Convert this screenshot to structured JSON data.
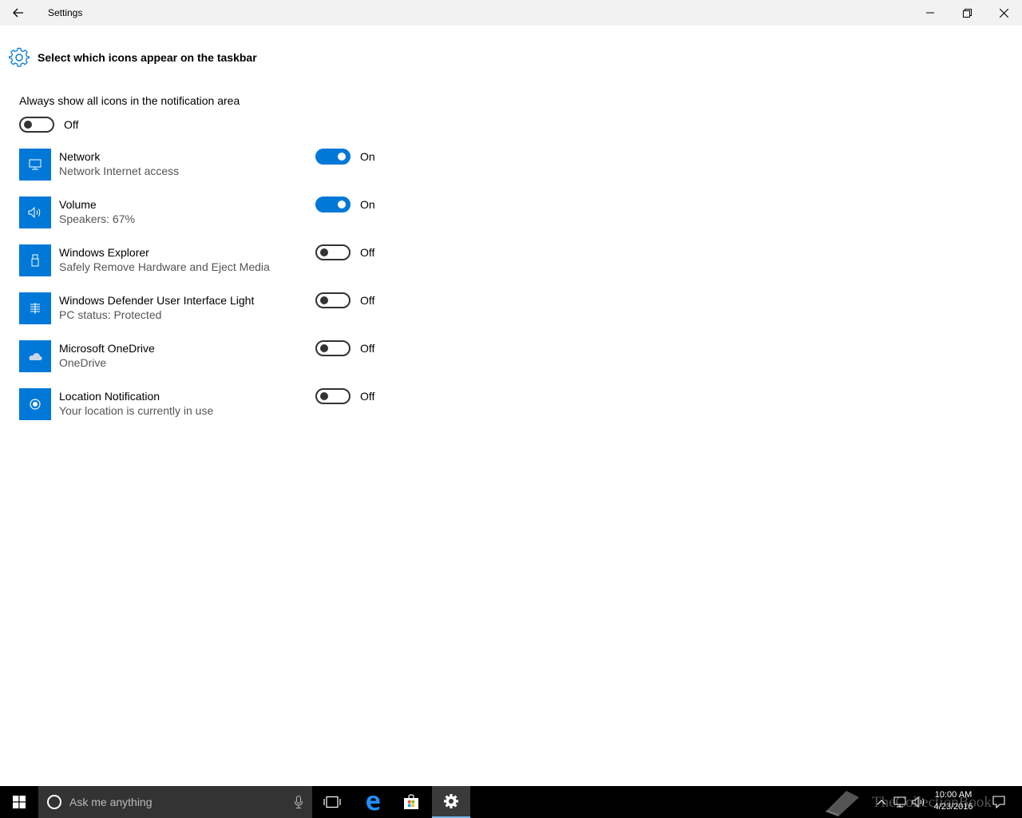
{
  "window": {
    "title": "Settings"
  },
  "page": {
    "title": "Select which icons appear on the taskbar"
  },
  "master": {
    "label": "Always show all icons in the notification area",
    "state": "Off"
  },
  "items": [
    {
      "title": "Network",
      "subtitle": "Network Internet access",
      "state": "On",
      "icon": "network-icon"
    },
    {
      "title": "Volume",
      "subtitle": "Speakers: 67%",
      "state": "On",
      "icon": "volume-icon"
    },
    {
      "title": "Windows Explorer",
      "subtitle": "Safely Remove Hardware and Eject Media",
      "state": "Off",
      "icon": "usb-icon"
    },
    {
      "title": "Windows Defender User Interface Light",
      "subtitle": "PC status: Protected",
      "state": "Off",
      "icon": "defender-icon"
    },
    {
      "title": "Microsoft OneDrive",
      "subtitle": "OneDrive",
      "state": "Off",
      "icon": "onedrive-icon"
    },
    {
      "title": "Location Notification",
      "subtitle": "Your location is currently in use",
      "state": "Off",
      "icon": "location-icon"
    }
  ],
  "taskbar": {
    "search_placeholder": "Ask me anything",
    "time": "10:00 AM",
    "date": "4/23/2016",
    "watermark": "TheCollectionBook"
  },
  "colors": {
    "accent": "#0078d7",
    "taskbar": "#000000",
    "titlebar": "#f2f2f2"
  }
}
